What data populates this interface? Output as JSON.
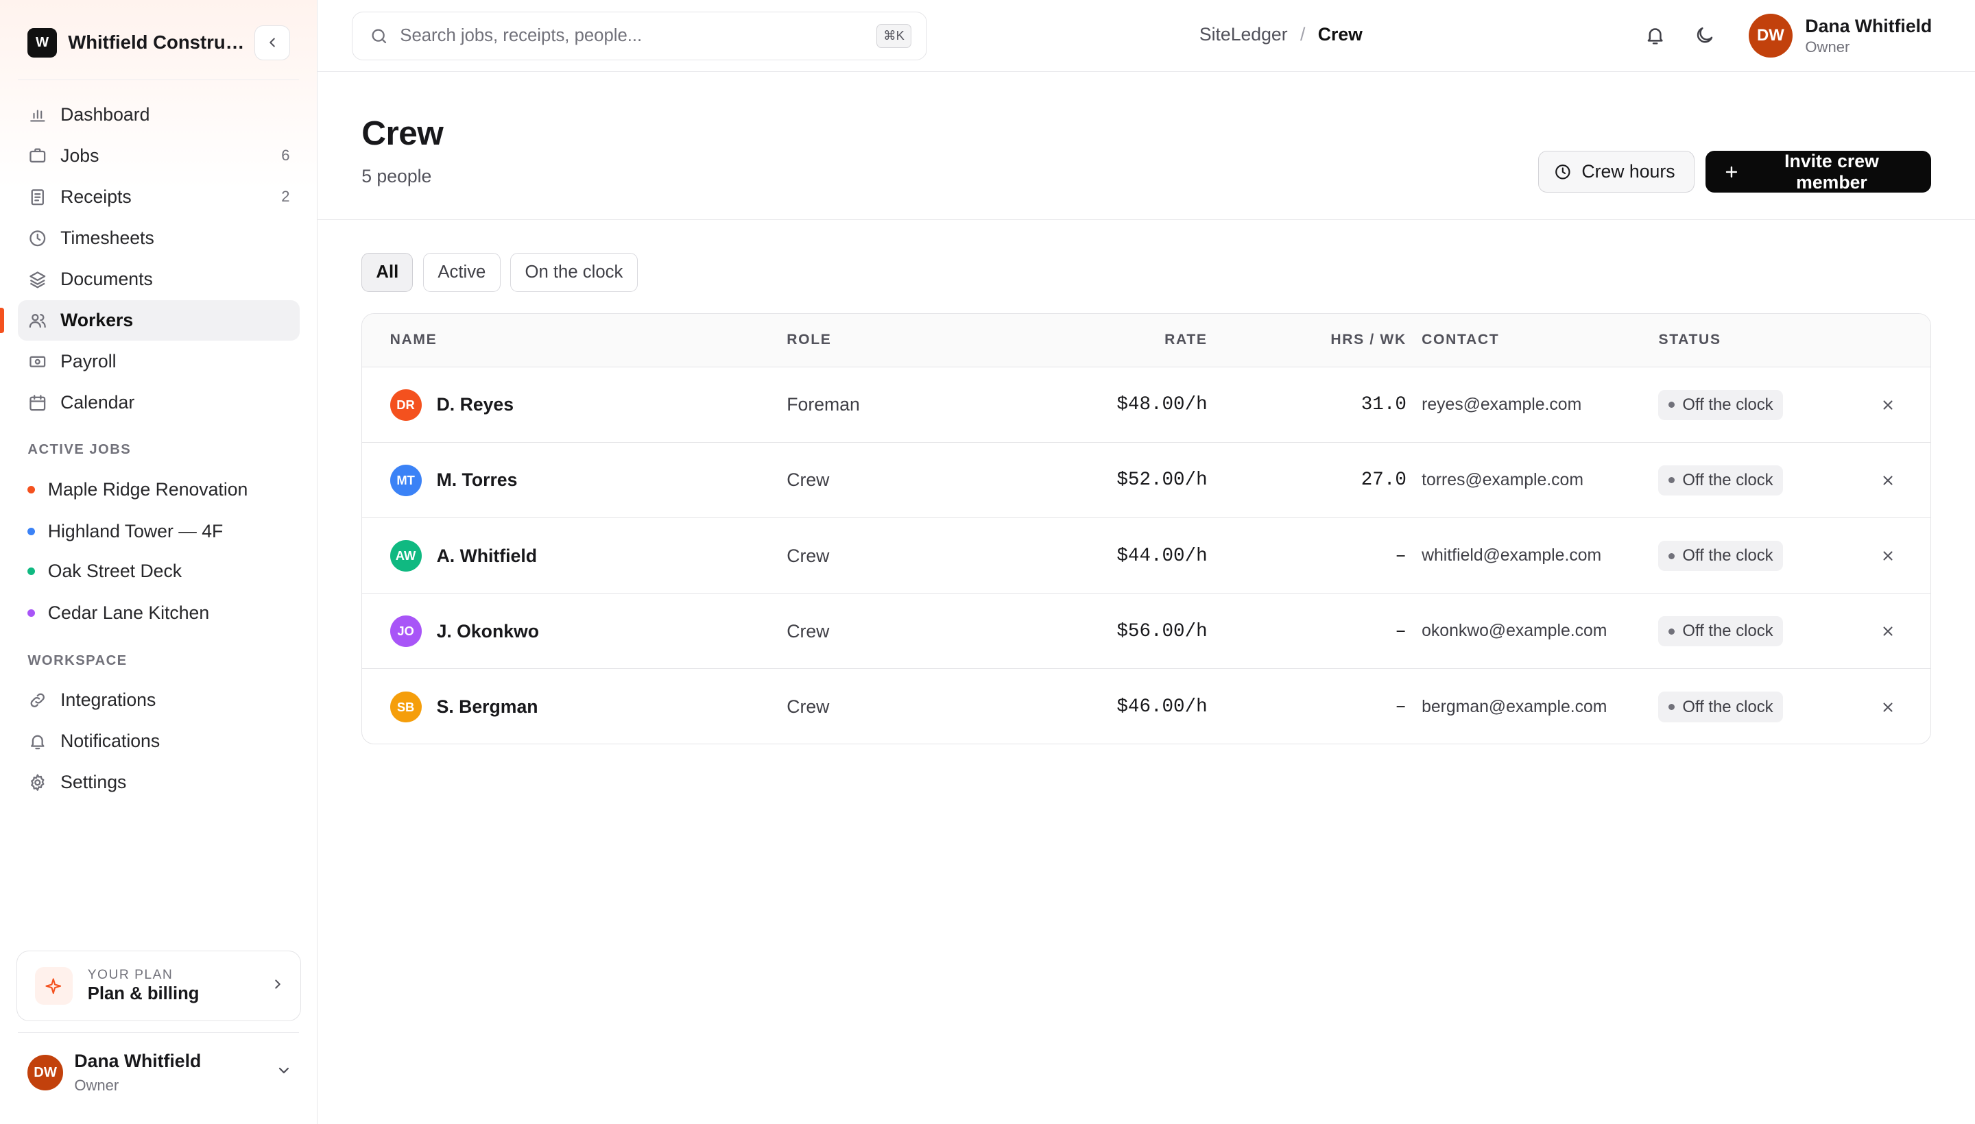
{
  "org": {
    "initial": "W",
    "name": "Whitfield Construction"
  },
  "nav": [
    {
      "label": "Dashboard",
      "icon": "bar-chart-icon",
      "count": ""
    },
    {
      "label": "Jobs",
      "icon": "briefcase-icon",
      "count": "6"
    },
    {
      "label": "Receipts",
      "icon": "receipt-icon",
      "count": "2"
    },
    {
      "label": "Timesheets",
      "icon": "clock-icon",
      "count": ""
    },
    {
      "label": "Documents",
      "icon": "layers-icon",
      "count": ""
    },
    {
      "label": "Workers",
      "icon": "users-icon",
      "count": "",
      "active": true
    },
    {
      "label": "Payroll",
      "icon": "banknote-icon",
      "count": ""
    },
    {
      "label": "Calendar",
      "icon": "calendar-icon",
      "count": ""
    }
  ],
  "active_jobs": {
    "label": "ACTIVE JOBS",
    "items": [
      {
        "label": "Maple Ridge Renovation",
        "color": "#f4511e"
      },
      {
        "label": "Highland Tower — 4F",
        "color": "#3b82f6"
      },
      {
        "label": "Oak Street Deck",
        "color": "#10b981"
      },
      {
        "label": "Cedar Lane Kitchen",
        "color": "#a855f7"
      }
    ]
  },
  "workspace": {
    "label": "WORKSPACE",
    "items": [
      {
        "label": "Integrations",
        "icon": "link-icon"
      },
      {
        "label": "Notifications",
        "icon": "bell-icon"
      },
      {
        "label": "Settings",
        "icon": "gear-icon"
      }
    ]
  },
  "plan": {
    "label": "YOUR PLAN",
    "title": "Plan & billing"
  },
  "user": {
    "initials": "DW",
    "name": "Dana Whitfield",
    "role": "Owner"
  },
  "search": {
    "placeholder": "Search jobs, receipts, people...",
    "shortcut": "⌘K"
  },
  "breadcrumb": {
    "root": "SiteLedger",
    "separator": "/",
    "current": "Crew"
  },
  "page": {
    "title": "Crew",
    "subtitle": "5 people",
    "crew_hours_label": "Crew hours",
    "invite_label": "Invite crew member"
  },
  "filters": [
    "All",
    "Active",
    "On the clock"
  ],
  "table": {
    "columns": {
      "name": "NAME",
      "role": "ROLE",
      "rate": "RATE",
      "hrs": "HRS / WK",
      "contact": "CONTACT",
      "status": "STATUS"
    },
    "rows": [
      {
        "initials": "DR",
        "color": "#f4511e",
        "name": "D. Reyes",
        "role": "Foreman",
        "rate": "$48.00/h",
        "hrs": "31.0",
        "contact": "reyes@example.com",
        "status": "Off the clock"
      },
      {
        "initials": "MT",
        "color": "#3b82f6",
        "name": "M. Torres",
        "role": "Crew",
        "rate": "$52.00/h",
        "hrs": "27.0",
        "contact": "torres@example.com",
        "status": "Off the clock"
      },
      {
        "initials": "AW",
        "color": "#10b981",
        "name": "A. Whitfield",
        "role": "Crew",
        "rate": "$44.00/h",
        "hrs": "–",
        "contact": "whitfield@example.com",
        "status": "Off the clock"
      },
      {
        "initials": "JO",
        "color": "#a855f7",
        "name": "J. Okonkwo",
        "role": "Crew",
        "rate": "$56.00/h",
        "hrs": "–",
        "contact": "okonkwo@example.com",
        "status": "Off the clock"
      },
      {
        "initials": "SB",
        "color": "#f59e0b",
        "name": "S. Bergman",
        "role": "Crew",
        "rate": "$46.00/h",
        "hrs": "–",
        "contact": "bergman@example.com",
        "status": "Off the clock"
      }
    ]
  }
}
